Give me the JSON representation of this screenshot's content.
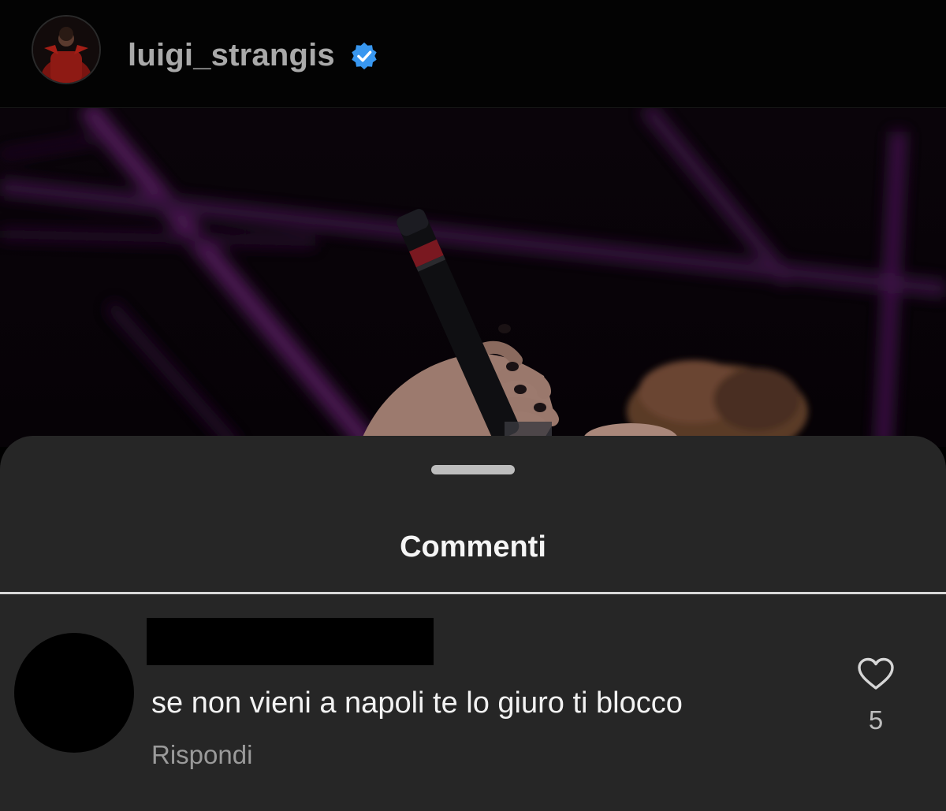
{
  "header": {
    "username": "luigi_strangis",
    "verified_icon": "verified-badge-icon",
    "verified_color": "#3897f0"
  },
  "post": {
    "image_description_icon": "concert-photo"
  },
  "comments_sheet": {
    "title": "Commenti",
    "comment": {
      "username": "",
      "text": "se non vieni a napoli te lo giuro ti blocco",
      "reply_label": "Rispondi",
      "likes": "5",
      "like_icon": "heart-outline-icon"
    }
  },
  "colors": {
    "background": "#000000",
    "sheet": "#262626",
    "accent_purple": "#7a2a8c"
  }
}
